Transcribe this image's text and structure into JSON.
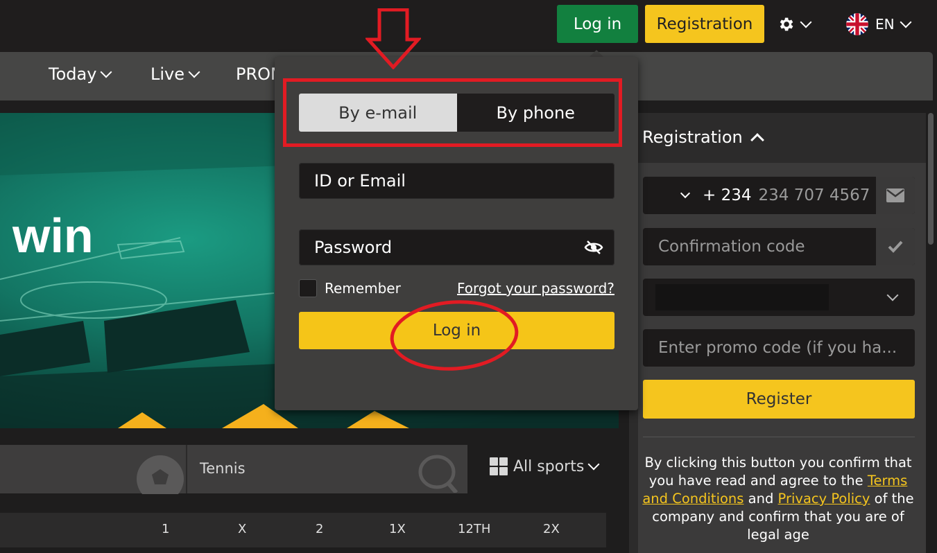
{
  "header": {
    "login_label": "Log in",
    "registration_label": "Registration",
    "language": "EN"
  },
  "nav": {
    "items": [
      {
        "label": "Today"
      },
      {
        "label": "Live"
      },
      {
        "label": "PROM"
      }
    ]
  },
  "banner": {
    "headline": "win"
  },
  "sports": {
    "tennis_label": "Tennis",
    "all_sports_label": "All sports"
  },
  "odds_header": [
    "1",
    "X",
    "2",
    "1X",
    "12TH",
    "2X"
  ],
  "login_dropdown": {
    "tabs": [
      {
        "label": "By e-mail",
        "active": true
      },
      {
        "label": "By phone",
        "active": false
      }
    ],
    "id_placeholder": "ID or Email",
    "password_placeholder": "Password",
    "remember_label": "Remember",
    "forgot_label": "Forgot your password?",
    "submit_label": "Log in"
  },
  "registration": {
    "title": "Registration",
    "phone_prefix": "+ 234",
    "phone_placeholder": "234 707 4567",
    "confirmation_placeholder": "Confirmation code",
    "promo_placeholder": "Enter promo code (if you ha...",
    "register_label": "Register",
    "note_before": "By clicking this button you confirm that you have read and agree to the",
    "terms_link": "Terms and Conditions",
    "note_and": "and",
    "privacy_link": "Privacy Policy",
    "note_after": "of the company and confirm that you are of legal age"
  },
  "colors": {
    "accent_yellow": "#f5c51e",
    "login_green": "#12803f",
    "annotation_red": "#e21b23"
  }
}
